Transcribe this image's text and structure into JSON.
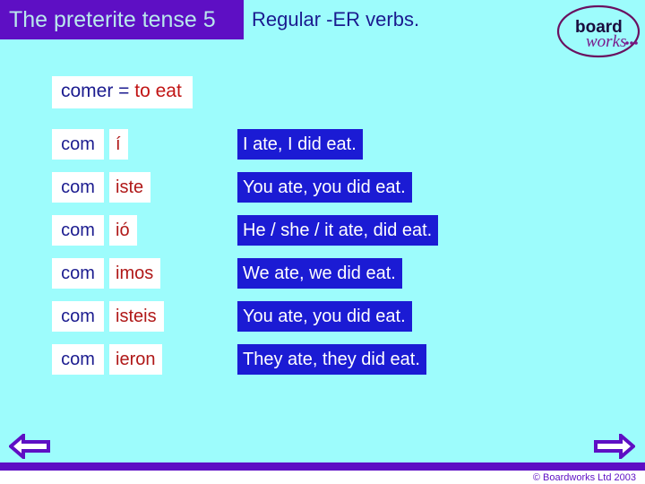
{
  "slide": {
    "title": "The preterite tense 5",
    "subtitle": "Regular -ER verbs.",
    "background_color": "#9dfcfc",
    "accent_color": "#5e0fc4"
  },
  "logo": {
    "name": "boardworks-logo",
    "word_top": "board",
    "word_bottom": "works"
  },
  "verb_heading": {
    "infinitive": "comer = ",
    "translation": "to eat"
  },
  "conjugation": {
    "stem": "com",
    "rows": [
      {
        "stem": "com",
        "ending": "í",
        "english": "I ate, I did eat."
      },
      {
        "stem": "com",
        "ending": "iste",
        "english": "You ate, you did eat."
      },
      {
        "stem": "com",
        "ending": "ió",
        "english": "He / she / it ate, did eat."
      },
      {
        "stem": "com",
        "ending": "imos",
        "english": "We ate, we did eat."
      },
      {
        "stem": "com",
        "ending": "isteis",
        "english": "You ate, you did eat."
      },
      {
        "stem": "com",
        "ending": "ieron",
        "english": "They ate, they did eat."
      }
    ]
  },
  "navigation": {
    "back_label": "back-arrow",
    "next_label": "forward-arrow"
  },
  "footer": {
    "copyright": "© Boardworks Ltd  2003"
  }
}
